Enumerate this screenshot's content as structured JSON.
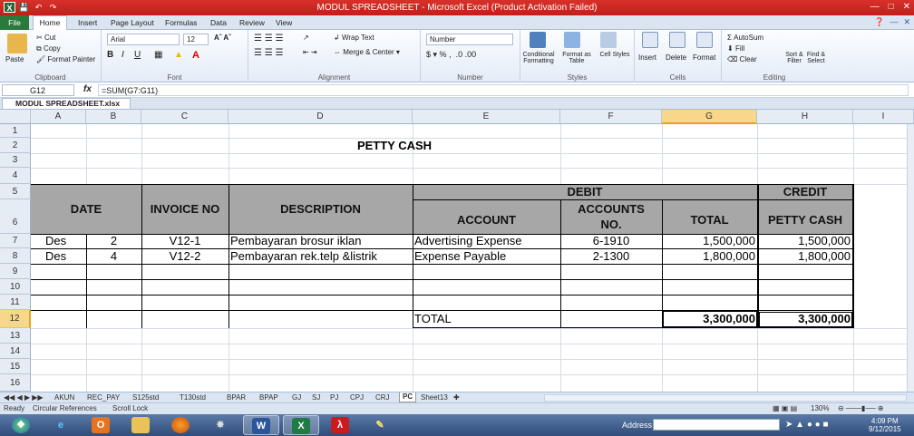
{
  "window": {
    "title": "MODUL SPREADSHEET - Microsoft Excel (Product Activation Failed)",
    "app_icon": "X"
  },
  "ribbon_tabs": [
    "File",
    "Home",
    "Insert",
    "Page Layout",
    "Formulas",
    "Data",
    "Review",
    "View"
  ],
  "ribbon": {
    "clipboard": {
      "label": "Clipboard",
      "paste": "Paste",
      "cut": "Cut",
      "copy": "Copy",
      "format_painter": "Format Painter"
    },
    "font": {
      "label": "Font",
      "name": "Arial",
      "size": "12"
    },
    "alignment": {
      "label": "Alignment",
      "wrap": "Wrap Text",
      "merge": "Merge & Center"
    },
    "number": {
      "label": "Number",
      "format": "Number",
      "currency": "$",
      "percent": "%",
      "comma": ","
    },
    "styles": {
      "label": "Styles",
      "conditional": "Conditional Formatting",
      "format_table": "Format as Table",
      "cell_styles": "Cell Styles"
    },
    "cells": {
      "label": "Cells",
      "insert": "Insert",
      "delete": "Delete",
      "format": "Format"
    },
    "editing": {
      "label": "Editing",
      "autosum": "AutoSum",
      "fill": "Fill",
      "clear": "Clear",
      "sort": "Sort & Filter",
      "find": "Find & Select"
    }
  },
  "formula_bar": {
    "name_box": "G12",
    "fx": "fx",
    "formula": "=SUM(G7:G11)"
  },
  "workbook_tab": "MODUL SPREADSHEET.xlsx",
  "columns": [
    "A",
    "B",
    "C",
    "D",
    "E",
    "F",
    "G",
    "H",
    "I"
  ],
  "rows": [
    "1",
    "2",
    "3",
    "4",
    "5",
    "6",
    "7",
    "8",
    "9",
    "10",
    "11",
    "12",
    "13",
    "14",
    "15",
    "16"
  ],
  "sheet": {
    "title": "PETTY CASH",
    "headers": {
      "date": "DATE",
      "invoice": "INVOICE NO",
      "description": "DESCRIPTION",
      "debit": "DEBIT",
      "credit": "CREDIT",
      "account": "ACCOUNT",
      "accounts_no_1": "ACCOUNTS",
      "accounts_no_2": "NO.",
      "total": "TOTAL",
      "petty_cash": "PETTY CASH"
    },
    "entries": [
      {
        "month": "Des",
        "day": "2",
        "invoice": "V12-1",
        "description": "Pembayaran brosur iklan",
        "account": "Advertising Expense",
        "account_no": "6-1910",
        "total": "1,500,000",
        "petty_cash": "1,500,000"
      },
      {
        "month": "Des",
        "day": "4",
        "invoice": "V12-2",
        "description": "Pembayaran rek.telp &listrik",
        "account": "Expense Payable",
        "account_no": "2-1300",
        "total": "1,800,000",
        "petty_cash": "1,800,000"
      }
    ],
    "total_label": "TOTAL",
    "total_debit": "3,300,000",
    "total_credit": "3,300,000"
  },
  "sheet_tabs": [
    "AKUN",
    "REC_PAY",
    "S125std",
    "T130std",
    "BPAR",
    "BPAP",
    "GJ",
    "SJ",
    "PJ",
    "CPJ",
    "CRJ",
    "PC",
    "Sheet13"
  ],
  "active_sheet": "PC",
  "status_bar": {
    "ready": "Ready",
    "circular": "Circular References",
    "scroll": "Scroll Lock",
    "zoom": "130%"
  },
  "taskbar": {
    "address": "Address",
    "time": "4:09 PM",
    "date": "9/12/2015"
  },
  "colors": {
    "accent": "#c8241d",
    "header_fill": "#a7a7a7",
    "selection": "#f8d68a"
  }
}
